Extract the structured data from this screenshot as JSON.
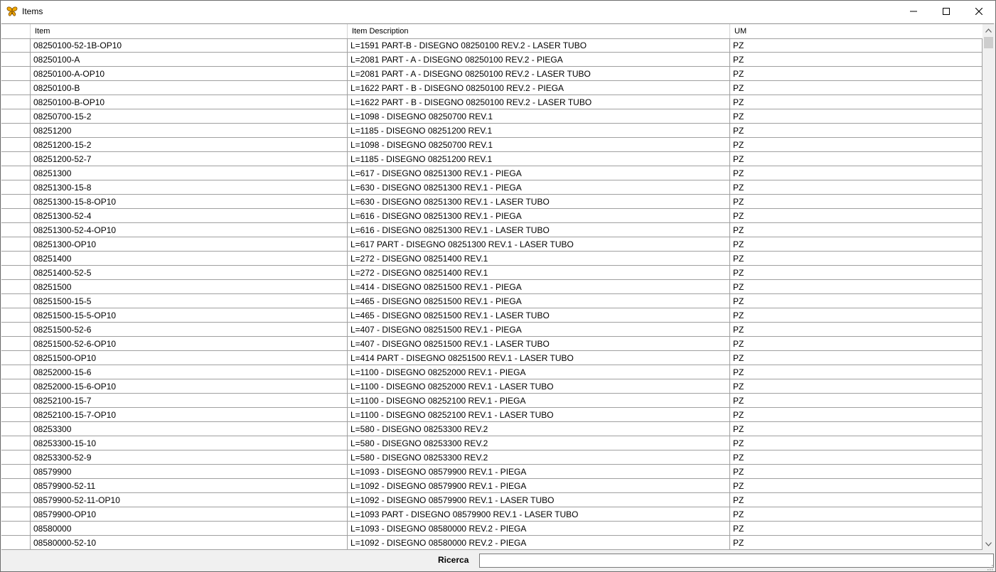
{
  "window": {
    "title": "Items"
  },
  "grid": {
    "columns": [
      "Item",
      "Item Description",
      "UM"
    ],
    "rows": [
      [
        "08250100-52-1B-OP10",
        "L=1591 PART-B - DISEGNO 08250100 REV.2 - LASER TUBO",
        "PZ"
      ],
      [
        "08250100-A",
        "L=2081 PART - A - DISEGNO 08250100 REV.2 - PIEGA",
        "PZ"
      ],
      [
        "08250100-A-OP10",
        "L=2081 PART - A - DISEGNO 08250100 REV.2 - LASER TUBO",
        "PZ"
      ],
      [
        "08250100-B",
        "L=1622 PART - B - DISEGNO 08250100 REV.2 - PIEGA",
        "PZ"
      ],
      [
        "08250100-B-OP10",
        "L=1622 PART - B - DISEGNO 08250100 REV.2 - LASER TUBO",
        "PZ"
      ],
      [
        "08250700-15-2",
        "L=1098 - DISEGNO 08250700 REV.1",
        "PZ"
      ],
      [
        "08251200",
        "L=1185 - DISEGNO 08251200 REV.1",
        "PZ"
      ],
      [
        "08251200-15-2",
        "L=1098 - DISEGNO 08250700 REV.1",
        "PZ"
      ],
      [
        "08251200-52-7",
        "L=1185 - DISEGNO 08251200 REV.1",
        "PZ"
      ],
      [
        "08251300",
        "L=617 - DISEGNO 08251300 REV.1 - PIEGA",
        "PZ"
      ],
      [
        "08251300-15-8",
        "L=630 - DISEGNO 08251300 REV.1 - PIEGA",
        "PZ"
      ],
      [
        "08251300-15-8-OP10",
        "L=630 - DISEGNO 08251300 REV.1 - LASER TUBO",
        "PZ"
      ],
      [
        "08251300-52-4",
        "L=616 - DISEGNO 08251300 REV.1 - PIEGA",
        "PZ"
      ],
      [
        "08251300-52-4-OP10",
        "L=616 - DISEGNO 08251300 REV.1 - LASER TUBO",
        "PZ"
      ],
      [
        "08251300-OP10",
        "L=617 PART - DISEGNO 08251300 REV.1 - LASER TUBO",
        "PZ"
      ],
      [
        "08251400",
        "L=272 - DISEGNO 08251400 REV.1",
        "PZ"
      ],
      [
        "08251400-52-5",
        "L=272 - DISEGNO 08251400 REV.1",
        "PZ"
      ],
      [
        "08251500",
        "L=414 - DISEGNO 08251500 REV.1 - PIEGA",
        "PZ"
      ],
      [
        "08251500-15-5",
        "L=465 - DISEGNO 08251500 REV.1 - PIEGA",
        "PZ"
      ],
      [
        "08251500-15-5-OP10",
        "L=465 - DISEGNO 08251500 REV.1 - LASER TUBO",
        "PZ"
      ],
      [
        "08251500-52-6",
        "L=407 - DISEGNO 08251500 REV.1 - PIEGA",
        "PZ"
      ],
      [
        "08251500-52-6-OP10",
        "L=407 - DISEGNO 08251500 REV.1 - LASER TUBO",
        "PZ"
      ],
      [
        "08251500-OP10",
        "L=414 PART - DISEGNO 08251500 REV.1 - LASER TUBO",
        "PZ"
      ],
      [
        "08252000-15-6",
        "L=1100 - DISEGNO 08252000 REV.1 - PIEGA",
        "PZ"
      ],
      [
        "08252000-15-6-OP10",
        "L=1100 - DISEGNO 08252000 REV.1 - LASER TUBO",
        "PZ"
      ],
      [
        "08252100-15-7",
        "L=1100 - DISEGNO 08252100 REV.1 - PIEGA",
        "PZ"
      ],
      [
        "08252100-15-7-OP10",
        "L=1100 - DISEGNO 08252100 REV.1 - LASER TUBO",
        "PZ"
      ],
      [
        "08253300",
        "L=580 - DISEGNO 08253300 REV.2",
        "PZ"
      ],
      [
        "08253300-15-10",
        "L=580 - DISEGNO 08253300 REV.2",
        "PZ"
      ],
      [
        "08253300-52-9",
        "L=580 - DISEGNO 08253300 REV.2",
        "PZ"
      ],
      [
        "08579900",
        "L=1093 - DISEGNO 08579900 REV.1 - PIEGA",
        "PZ"
      ],
      [
        "08579900-52-11",
        "L=1092 - DISEGNO 08579900 REV.1 - PIEGA",
        "PZ"
      ],
      [
        "08579900-52-11-OP10",
        "L=1092 - DISEGNO 08579900 REV.1 - LASER TUBO",
        "PZ"
      ],
      [
        "08579900-OP10",
        "L=1093 PART - DISEGNO 08579900 REV.1 - LASER TUBO",
        "PZ"
      ],
      [
        "08580000",
        "L=1093 - DISEGNO 08580000 REV.2 - PIEGA",
        "PZ"
      ],
      [
        "08580000-52-10",
        "L=1092 - DISEGNO 08580000 REV.2 - PIEGA",
        "PZ"
      ]
    ]
  },
  "search": {
    "label": "Ricerca",
    "value": ""
  },
  "icons": {
    "app": "butterfly-icon",
    "minimize": "minimize-icon",
    "maximize": "maximize-icon",
    "close": "close-icon",
    "scroll_up": "chevron-up-icon",
    "scroll_down": "chevron-down-icon",
    "resize": "resize-grip-icon"
  },
  "colors": {
    "app_icon": "#f0a800",
    "grid_line": "#a0a0a0",
    "window_bg": "#f0f0f0"
  }
}
